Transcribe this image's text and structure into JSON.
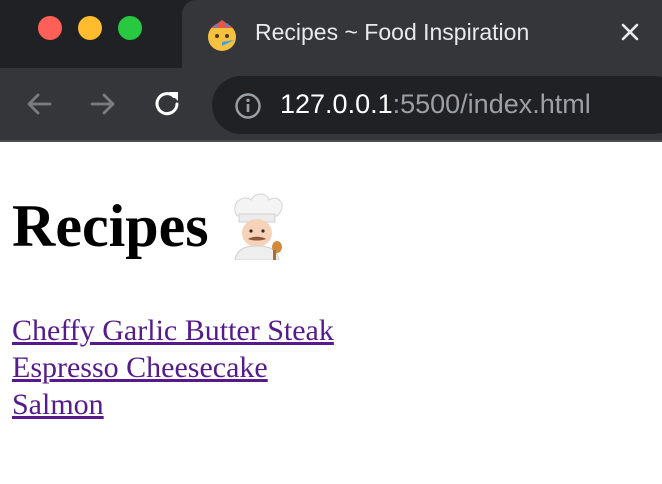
{
  "browser": {
    "tab": {
      "title": "Recipes ~ Food Inspiration",
      "favicon": "party-face-emoji",
      "close_icon": "close-icon"
    },
    "address_bar": {
      "host": "127.0.0.1",
      "rest": ":5500/index.html",
      "info_icon": "info-icon"
    },
    "nav": {
      "back_icon": "arrow-left-icon",
      "forward_icon": "arrow-right-icon",
      "reload_icon": "reload-icon"
    },
    "window_controls": [
      "close",
      "minimize",
      "zoom"
    ]
  },
  "page": {
    "heading": "Recipes",
    "heading_emoji": "chef-emoji",
    "links": [
      {
        "label": "Cheffy Garlic Butter Steak"
      },
      {
        "label": "Espresso Cheesecake"
      },
      {
        "label": "Salmon"
      }
    ]
  },
  "colors": {
    "titlebar": "#202124",
    "tab": "#35363a",
    "omnibox": "#202124",
    "visited_link": "#551a8b",
    "traffic_red": "#fe5f57",
    "traffic_yellow": "#febc2e",
    "traffic_green": "#28c840"
  }
}
